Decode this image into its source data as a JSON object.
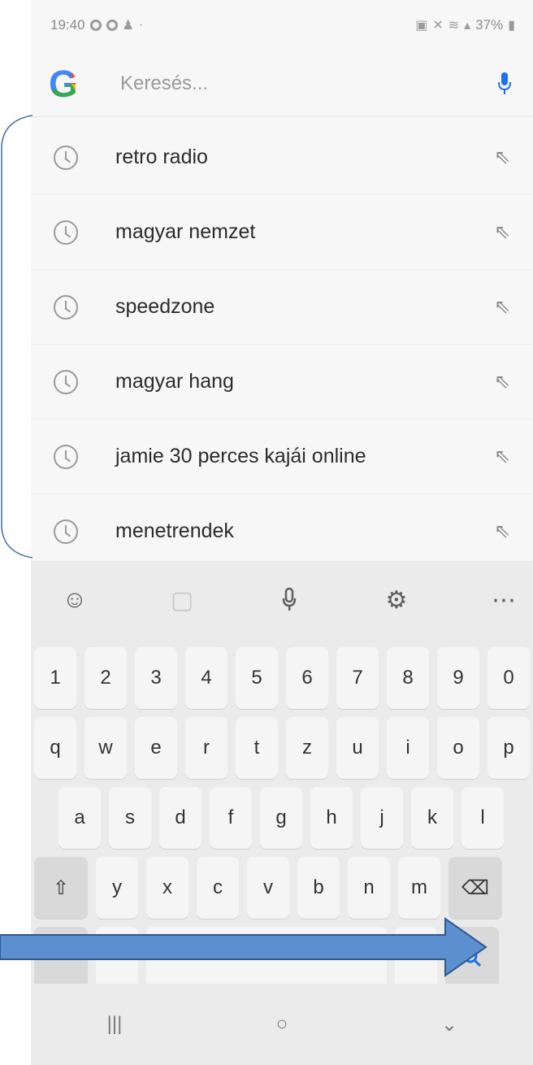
{
  "status_bar": {
    "time": "19:40",
    "battery": "37%",
    "left_icons": [
      "notification-dot-icon",
      "notification-dot-icon",
      "bell-icon",
      "dot-icon"
    ],
    "right_icons": [
      "nfc-icon",
      "mute-icon",
      "wifi-icon",
      "signal-icon",
      "battery-icon"
    ]
  },
  "search": {
    "logo": "G",
    "placeholder": "Keresés...",
    "value": "",
    "mic_icon": "mic-icon"
  },
  "suggestions": [
    {
      "text": "retro radio",
      "icon": "history-clock-icon",
      "action_icon": "arrow-up-left-icon"
    },
    {
      "text": "magyar nemzet",
      "icon": "history-clock-icon",
      "action_icon": "arrow-up-left-icon"
    },
    {
      "text": "speedzone",
      "icon": "history-clock-icon",
      "action_icon": "arrow-up-left-icon"
    },
    {
      "text": "magyar hang",
      "icon": "history-clock-icon",
      "action_icon": "arrow-up-left-icon"
    },
    {
      "text": "jamie 30 perces kajái online",
      "icon": "history-clock-icon",
      "action_icon": "arrow-up-left-icon"
    },
    {
      "text": "menetrendek",
      "icon": "history-clock-icon",
      "action_icon": "arrow-up-left-icon"
    }
  ],
  "keyboard": {
    "toolbar": [
      "emoji-icon",
      "sticker-icon",
      "mic-icon",
      "settings-icon",
      "more-icon"
    ],
    "rows": [
      [
        "1",
        "2",
        "3",
        "4",
        "5",
        "6",
        "7",
        "8",
        "9",
        "0"
      ],
      [
        "q",
        "w",
        "e",
        "r",
        "t",
        "z",
        "u",
        "i",
        "o",
        "p"
      ],
      [
        "a",
        "s",
        "d",
        "f",
        "g",
        "h",
        "j",
        "k",
        "l"
      ],
      [
        "y",
        "x",
        "c",
        "v",
        "b",
        "n",
        "m"
      ]
    ],
    "shift_icon": "shift-icon",
    "backspace_icon": "backspace-icon",
    "search_key_icon": "search-icon"
  },
  "nav": [
    "recents-icon",
    "home-icon",
    "back-icon"
  ],
  "colors": {
    "arrow_fill": "#5b8fd0",
    "arrow_stroke": "#2f5a8f",
    "bracket": "#3f6ea8",
    "search_key_accent": "#1a73e8"
  }
}
